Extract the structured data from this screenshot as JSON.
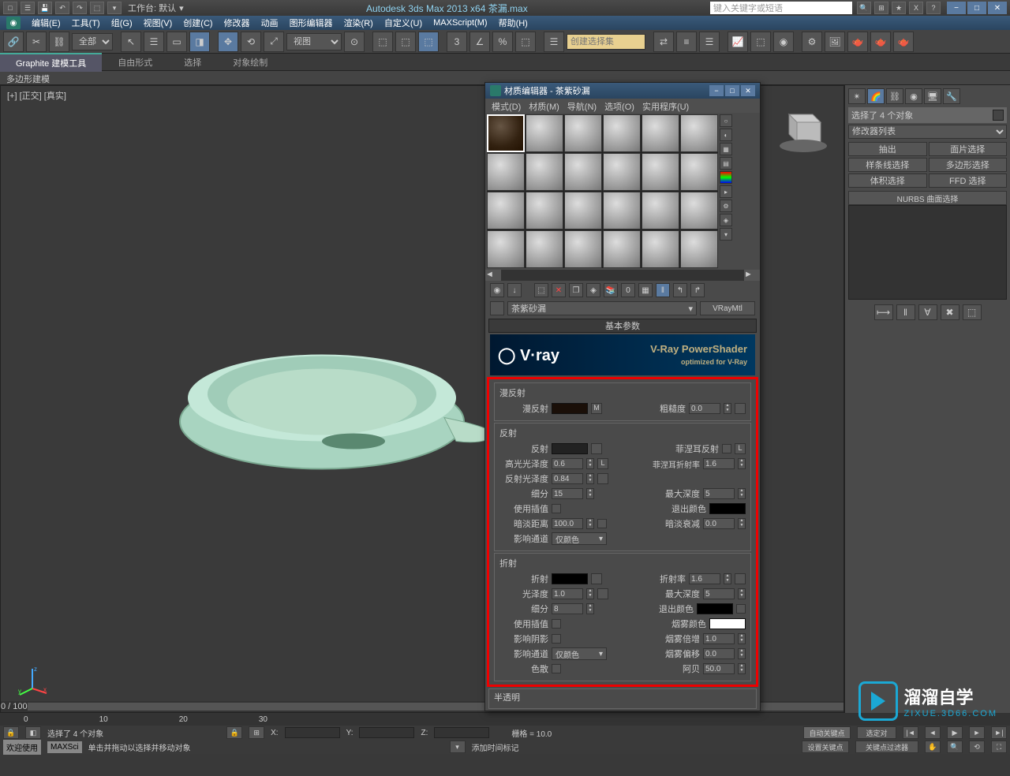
{
  "titlebar": {
    "workspace_label": "工作台: 默认",
    "app_title": "Autodesk 3ds Max  2013 x64   茶漏.max",
    "search_placeholder": "键入关键字或短语"
  },
  "menubar": {
    "items": [
      "编辑(E)",
      "工具(T)",
      "组(G)",
      "视图(V)",
      "创建(C)",
      "修改器",
      "动画",
      "图形编辑器",
      "渲染(R)",
      "自定义(U)",
      "MAXScript(M)",
      "帮助(H)"
    ]
  },
  "toolbar": {
    "filter_all": "全部",
    "view_dd": "视图",
    "selset_placeholder": "创建选择集"
  },
  "ribbon": {
    "tabs": [
      "Graphite 建模工具",
      "自由形式",
      "选择",
      "对象绘制"
    ],
    "sub": "多边形建模"
  },
  "viewport": {
    "label": "[+] [正交] [真实]",
    "timeline_marker": "0 / 100"
  },
  "right_panel": {
    "selection_info": "选择了 4 个对象",
    "modifier_list": "修改器列表",
    "buttons": [
      "抽出",
      "面片选择",
      "样条线选择",
      "多边形选择",
      "体积选择",
      "FFD 选择"
    ],
    "nurbs": "NURBS 曲面选择"
  },
  "mat_editor": {
    "title": "材质编辑器 - 茶紫砂漏",
    "menu": [
      "模式(D)",
      "材质(M)",
      "导航(N)",
      "选项(O)",
      "实用程序(U)"
    ],
    "material_name": "茶紫砂漏",
    "material_type": "VRayMtl",
    "rollout_basic": "基本参数",
    "vray_banner": "V-Ray PowerShader",
    "vray_sub": "optimized for V-Ray",
    "vray_logo": "V·ray",
    "diffuse": {
      "group": "漫反射",
      "label": "漫反射",
      "map": "M",
      "rough_label": "粗糙度",
      "rough_val": "0.0"
    },
    "reflect": {
      "group": "反射",
      "label": "反射",
      "hglossy_label": "高光光泽度",
      "hglossy_val": "0.6",
      "L": "L",
      "rglossy_label": "反射光泽度",
      "rglossy_val": "0.84",
      "fresnel_label": "菲涅耳反射",
      "fresnel_ior_label": "菲涅耳折射率",
      "fresnel_ior_val": "1.6",
      "subdiv_label": "细分",
      "subdiv_val": "15",
      "maxdepth_label": "最大深度",
      "maxdepth_val": "5",
      "interp_label": "使用插值",
      "exit_label": "退出颜色",
      "dim_label": "暗淡距离",
      "dim_val": "100.0",
      "dimfall_label": "暗淡衰减",
      "dimfall_val": "0.0",
      "affect_label": "影响通道",
      "affect_val": "仅颜色"
    },
    "refract": {
      "group": "折射",
      "label": "折射",
      "ior_label": "折射率",
      "ior_val": "1.6",
      "glossy_label": "光泽度",
      "glossy_val": "1.0",
      "maxdepth_label": "最大深度",
      "maxdepth_val": "5",
      "subdiv_label": "细分",
      "subdiv_val": "8",
      "exit_label": "退出颜色",
      "interp_label": "使用插值",
      "fog_label": "烟雾颜色",
      "shadow_label": "影响阴影",
      "fogmult_label": "烟雾倍增",
      "fogmult_val": "1.0",
      "affect_label": "影响通道",
      "affect_val": "仅颜色",
      "fogbias_label": "烟雾偏移",
      "fogbias_val": "0.0",
      "disp_label": "色散",
      "abbe_label": "阿贝",
      "abbe_val": "50.0"
    },
    "translucency_hdr": "半透明"
  },
  "status": {
    "sel_msg": "选择了 4 个对象",
    "prompt": "单击并拖动以选择并移动对象",
    "x": "X:",
    "y": "Y:",
    "z": "Z:",
    "grid": "栅格 = 10.0",
    "autokey": "自动关键点",
    "selkey": "选定对",
    "addtime": "添加时间标记",
    "setkey": "设置关键点",
    "keyfilter": "关键点过滤器",
    "welcome": "欢迎使用",
    "maxsc": "MAXSci"
  },
  "watermark": {
    "text": "溜溜自学",
    "url": "ZIXUE.3D66.COM"
  }
}
